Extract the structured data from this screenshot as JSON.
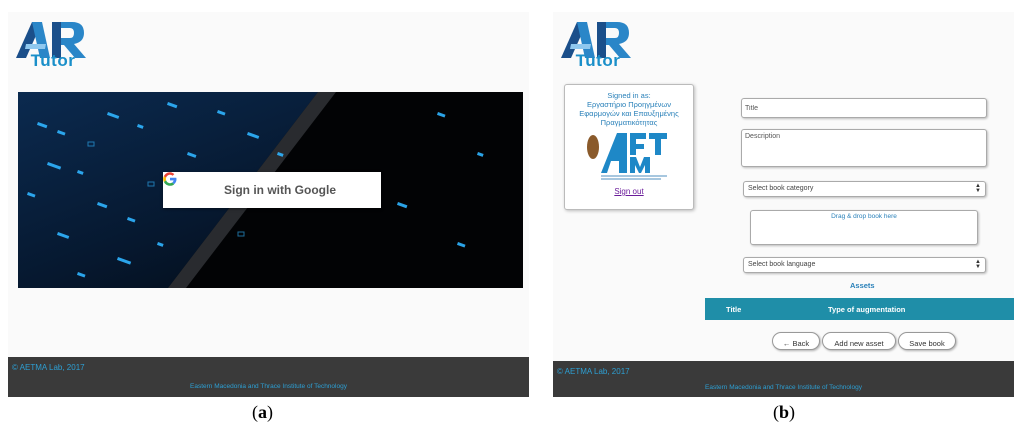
{
  "logo": {
    "letters": "AR",
    "word": "Tutor"
  },
  "panel_a": {
    "google_button_label": "Sign in with Google",
    "footer": {
      "copyright": "© AETMA Lab, 2017",
      "institute": "Eastern Macedonia and Thrace Institute of Technology"
    }
  },
  "panel_b": {
    "signed_in_label": "Signed in as:",
    "lab_name": "Εργαστήριο Προηγμένων Εφαρμογών και Επαυξημένης Πραγματικότητας",
    "sign_out_label": "Sign out",
    "title_placeholder": "Title",
    "description_placeholder": "Description",
    "category_select": "Select book category",
    "dropzone_label": "Drag & drop book here",
    "language_select": "Select book language",
    "assets_title": "Assets",
    "assets_columns": [
      "Title",
      "Type of augmentation"
    ],
    "buttons": {
      "back": "← Back",
      "add_asset": "Add new asset",
      "save": "Save book"
    },
    "footer": {
      "copyright": "© AETMA Lab, 2017",
      "institute": "Eastern Macedonia and Thrace Institute of Technology"
    }
  },
  "captions": {
    "a": "a",
    "b": "b"
  },
  "colors": {
    "accent": "#1f8ea8",
    "link": "#2980b9",
    "footer_bg": "#3a3a3a",
    "footer_text": "#2d9fd3"
  }
}
